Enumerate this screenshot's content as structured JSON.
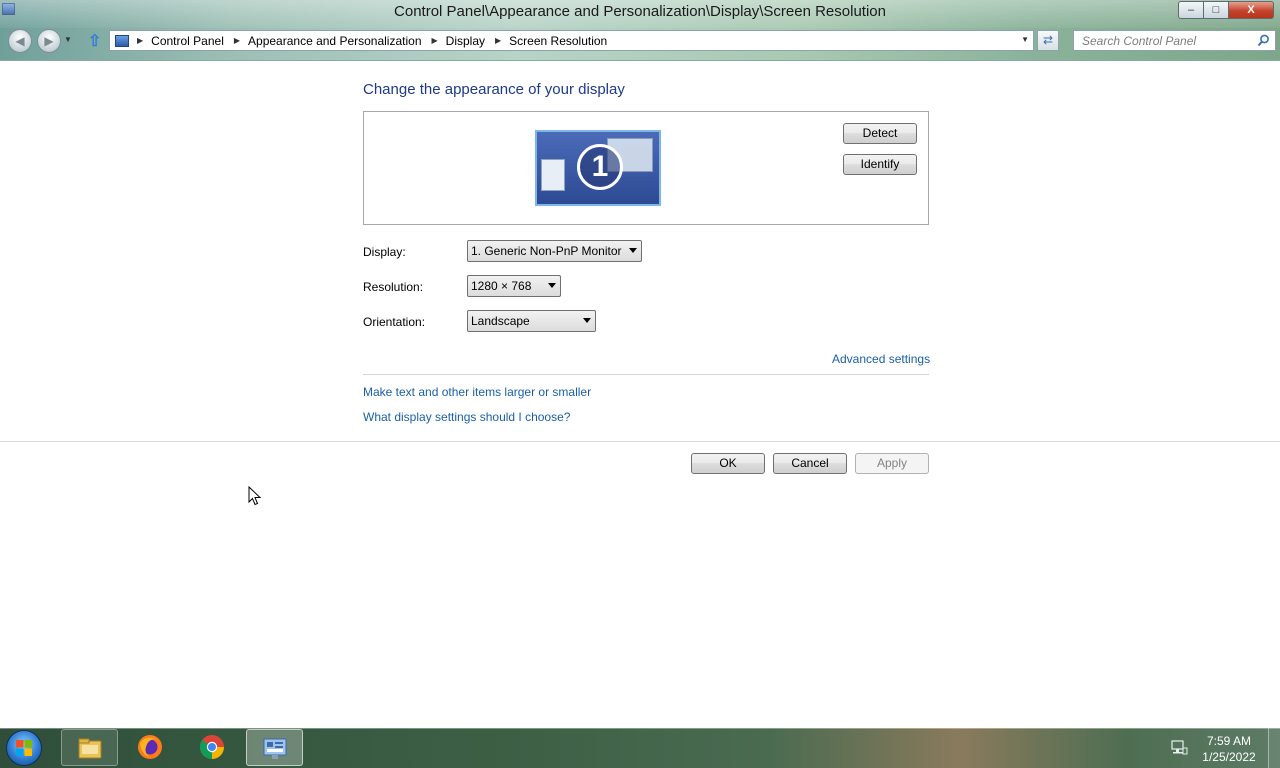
{
  "window": {
    "title": "Control Panel\\Appearance and Personalization\\Display\\Screen Resolution",
    "controls": {
      "minimize": "–",
      "maximize": "□",
      "close": "X"
    }
  },
  "nav": {
    "back_icon": "back-arrow-icon",
    "forward_icon": "forward-arrow-icon",
    "breadcrumbs": [
      "Control Panel",
      "Appearance and Personalization",
      "Display",
      "Screen Resolution"
    ],
    "search_placeholder": "Search Control Panel"
  },
  "main": {
    "heading": "Change the appearance of your display",
    "monitor_number": "1",
    "detect_label": "Detect",
    "identify_label": "Identify",
    "display_label": "Display:",
    "display_value": "1. Generic Non-PnP Monitor",
    "resolution_label": "Resolution:",
    "resolution_value": "1280 × 768",
    "orientation_label": "Orientation:",
    "orientation_value": "Landscape",
    "advanced_link": "Advanced settings",
    "text_size_link": "Make text and other items larger or smaller",
    "help_link": "What display settings should I choose?"
  },
  "footer": {
    "ok_label": "OK",
    "cancel_label": "Cancel",
    "apply_label": "Apply",
    "apply_enabled": false
  },
  "taskbar": {
    "pinned": [
      "file-explorer-icon",
      "firefox-icon",
      "chrome-icon",
      "control-panel-icon"
    ],
    "active": "control-panel-icon",
    "clock_time": "7:59 AM",
    "clock_date": "1/25/2022"
  },
  "colors": {
    "heading": "#1e3a8a",
    "link": "#1a5fa8",
    "monitor_fill": "#3a5aa8"
  }
}
